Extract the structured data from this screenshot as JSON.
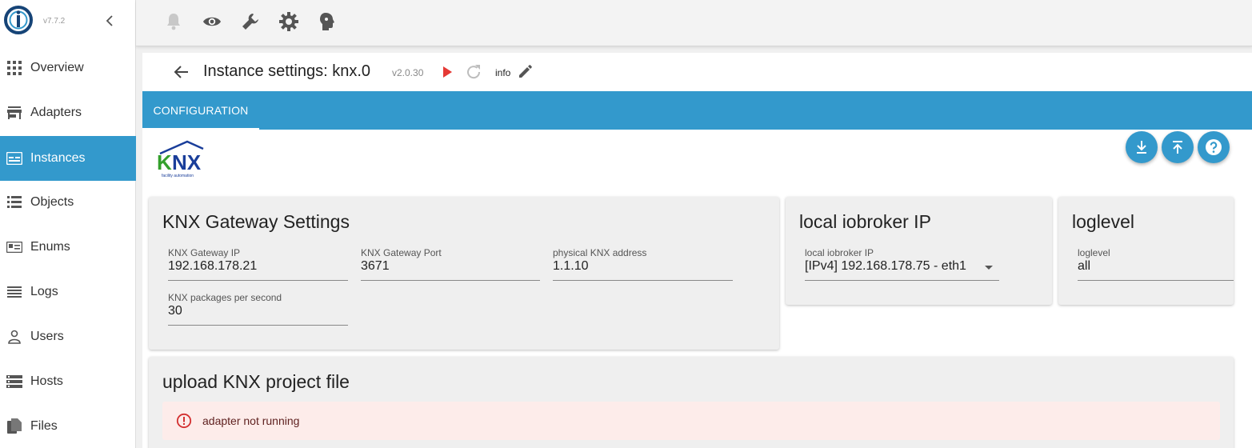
{
  "app": {
    "version": "v7.7.2"
  },
  "sidebar": {
    "items": [
      {
        "label": "Overview",
        "icon": "apps-grid-icon"
      },
      {
        "label": "Adapters",
        "icon": "store-icon"
      },
      {
        "label": "Instances",
        "icon": "instances-icon",
        "active": true
      },
      {
        "label": "Objects",
        "icon": "list-icon"
      },
      {
        "label": "Enums",
        "icon": "enum-card-icon"
      },
      {
        "label": "Logs",
        "icon": "lines-icon"
      },
      {
        "label": "Users",
        "icon": "person-icon"
      },
      {
        "label": "Hosts",
        "icon": "storage-icon"
      },
      {
        "label": "Files",
        "icon": "files-icon"
      }
    ]
  },
  "toolbar": {
    "icons": [
      "bell-icon",
      "eye-icon",
      "wrench-icon",
      "settings-icon",
      "expert-mode-icon"
    ]
  },
  "header": {
    "title": "Instance settings: knx.0",
    "instance_version": "v2.0.30",
    "info_label": "info"
  },
  "tabs": [
    {
      "label": "CONFIGURATION",
      "active": true
    }
  ],
  "config": {
    "logo_text": "KNX",
    "logo_subtext": "facility automation",
    "gateway_card": {
      "title": "KNX Gateway Settings",
      "fields": [
        {
          "label": "KNX Gateway IP",
          "value": "192.168.178.21"
        },
        {
          "label": "KNX Gateway Port",
          "value": "3671"
        },
        {
          "label": "physical KNX address",
          "value": "1.1.10"
        },
        {
          "label": "KNX packages per second",
          "value": "30"
        }
      ]
    },
    "local_ip_card": {
      "title": "local iobroker IP",
      "field": {
        "label": "local iobroker IP",
        "value": "[IPv4] 192.168.178.75 - eth1"
      }
    },
    "loglevel_card": {
      "title": "loglevel",
      "field": {
        "label": "loglevel",
        "value": "all"
      }
    },
    "upload_card": {
      "title": "upload KNX project file",
      "alert": "adapter not running"
    }
  },
  "colors": {
    "accent": "#3399cc",
    "play": "#e53935",
    "alert_bg": "#fdecea",
    "alert_icon": "#d32f2f",
    "knx_green": "#33a02c",
    "knx_blue": "#1a3e9a"
  }
}
